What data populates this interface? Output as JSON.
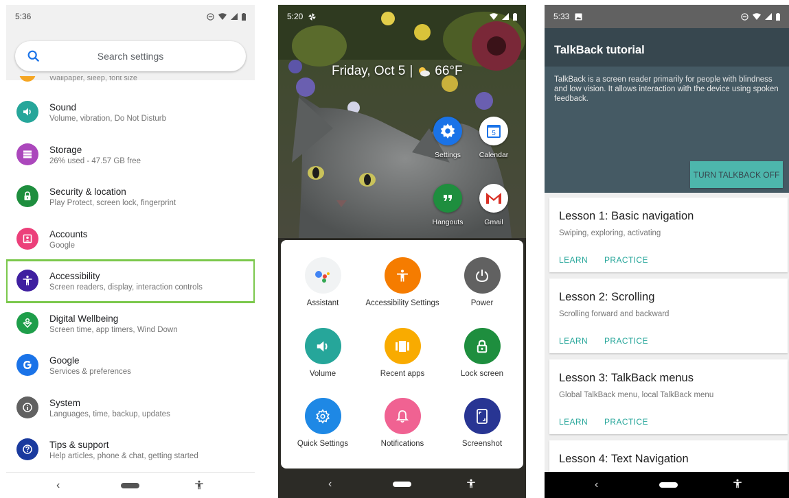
{
  "settings_screen": {
    "status_time": "5:36",
    "search": {
      "placeholder": "Search settings"
    },
    "cutoff_text": "Wallpaper, sleep, font size",
    "items": [
      {
        "title": "Sound",
        "subtitle": "Volume, vibration, Do Not Disturb",
        "icon": "volume-icon",
        "color": "#26a69a"
      },
      {
        "title": "Storage",
        "subtitle": "26% used - 47.57 GB free",
        "icon": "storage-icon",
        "color": "#ab47bc"
      },
      {
        "title": "Security & location",
        "subtitle": "Play Protect, screen lock, fingerprint",
        "icon": "lock-icon",
        "color": "#1e8e3e"
      },
      {
        "title": "Accounts",
        "subtitle": "Google",
        "icon": "account-icon",
        "color": "#ec407a"
      },
      {
        "title": "Accessibility",
        "subtitle": "Screen readers, display, interaction controls",
        "icon": "accessibility-icon",
        "color": "#3f1fa0",
        "highlighted": true
      },
      {
        "title": "Digital Wellbeing",
        "subtitle": "Screen time, app timers, Wind Down",
        "icon": "wellbeing-icon",
        "color": "#1e9e4a"
      },
      {
        "title": "Google",
        "subtitle": "Services & preferences",
        "icon": "google-icon",
        "color": "#1a73e8"
      },
      {
        "title": "System",
        "subtitle": "Languages, time, backup, updates",
        "icon": "info-icon",
        "color": "#616161"
      },
      {
        "title": "Tips & support",
        "subtitle": "Help articles, phone & chat, getting started",
        "icon": "help-icon",
        "color": "#1a3a9e"
      }
    ],
    "nav": {
      "back": "‹"
    }
  },
  "home_screen": {
    "status_time": "5:20",
    "date": "Friday, Oct 5",
    "separator": "|",
    "temperature": "66°F",
    "calendar_day": "5",
    "apps": [
      {
        "label": "Settings"
      },
      {
        "label": "Calendar"
      },
      {
        "label": "Hangouts"
      },
      {
        "label": "Gmail"
      }
    ],
    "menu": [
      {
        "label": "Assistant",
        "color": "#f1f3f4"
      },
      {
        "label": "Accessibility Settings",
        "color": "#f57c00"
      },
      {
        "label": "Power",
        "color": "#616161"
      },
      {
        "label": "Volume",
        "color": "#26a69a"
      },
      {
        "label": "Recent apps",
        "color": "#f9ab00"
      },
      {
        "label": "Lock screen",
        "color": "#1e8e3e"
      },
      {
        "label": "Quick Settings",
        "color": "#1e88e5"
      },
      {
        "label": "Notifications",
        "color": "#f06292"
      },
      {
        "label": "Screenshot",
        "color": "#283593"
      }
    ],
    "nav": {
      "back": "‹"
    }
  },
  "talkback_screen": {
    "status_time": "5:33",
    "title": "TalkBack tutorial",
    "description": "TalkBack is a screen reader primarily for people with blindness and low vision. It allows interaction with the device using spoken feedback.",
    "turn_off_button": "TURN TALKBACK OFF",
    "lessons": [
      {
        "title": "Lesson 1: Basic navigation",
        "subtitle": "Swiping, exploring, activating",
        "learn": "LEARN",
        "practice": "PRACTICE"
      },
      {
        "title": "Lesson 2: Scrolling",
        "subtitle": "Scrolling forward and backward",
        "learn": "LEARN",
        "practice": "PRACTICE"
      },
      {
        "title": "Lesson 3: TalkBack menus",
        "subtitle": "Global TalkBack menu, local TalkBack menu",
        "learn": "LEARN",
        "practice": "PRACTICE"
      },
      {
        "title": "Lesson 4: Text Navigation",
        "subtitle": "",
        "learn": "",
        "practice": ""
      }
    ],
    "nav": {
      "back": "‹"
    }
  }
}
